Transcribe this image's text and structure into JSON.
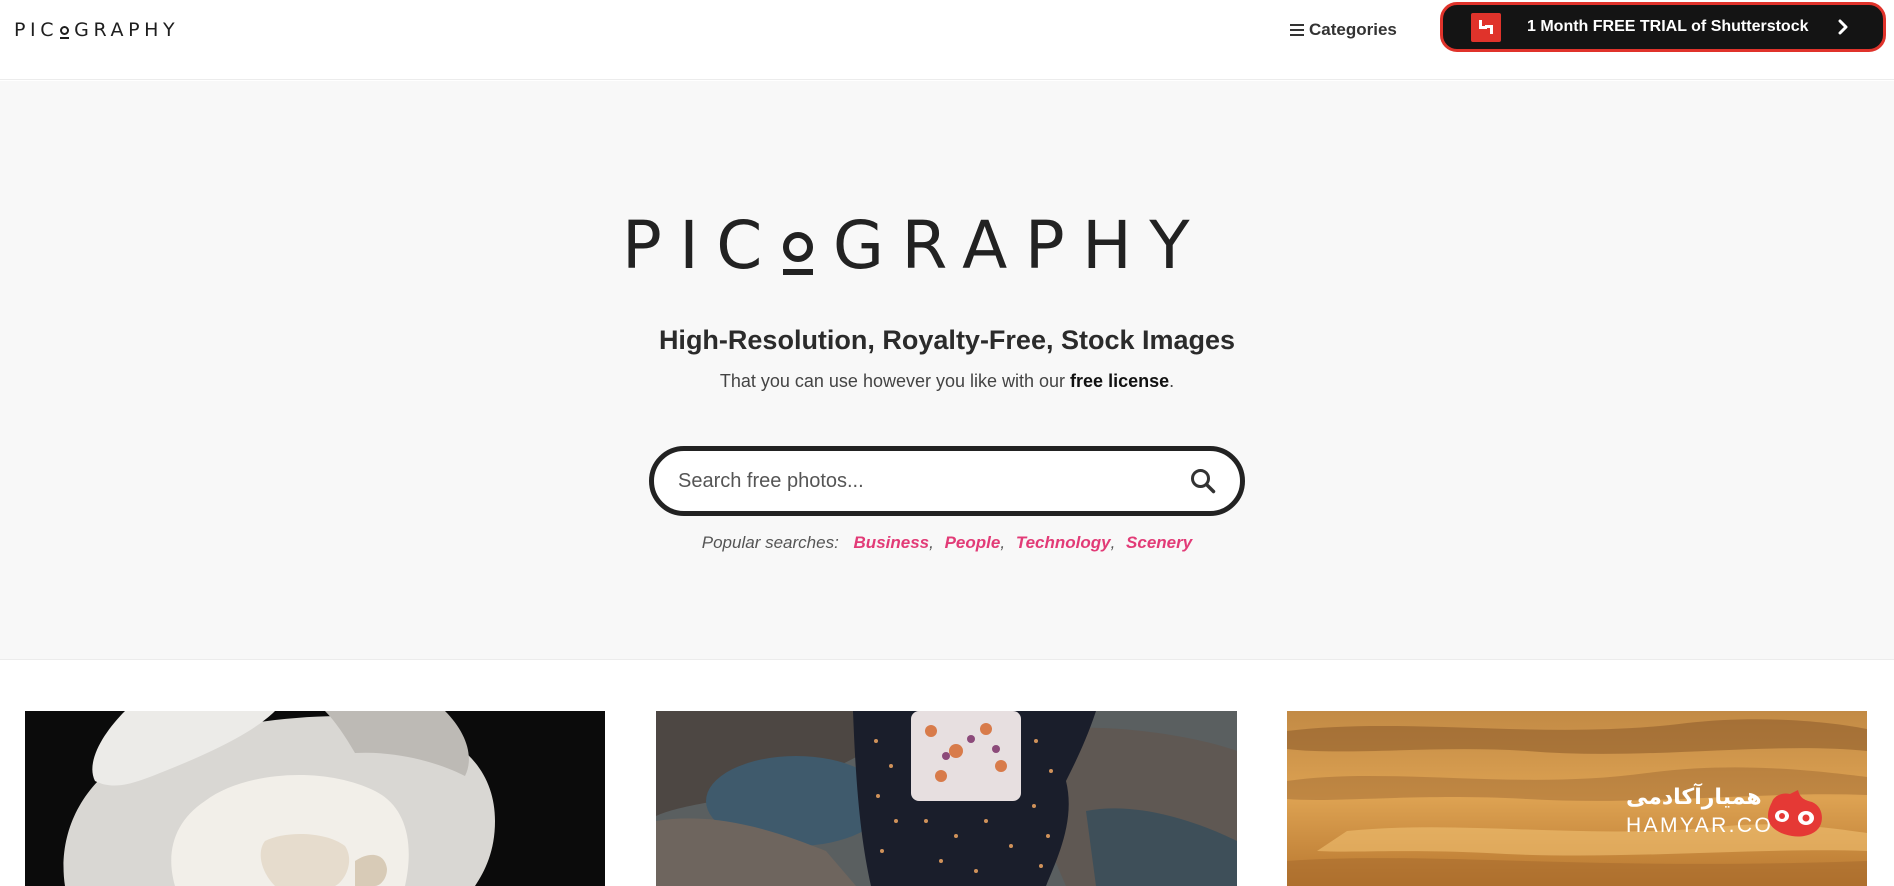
{
  "header": {
    "logo_text_left": "PIC",
    "logo_text_right": "GRAPHY",
    "categories_label": "Categories",
    "trial_button_label": "1 Month FREE TRIAL of Shutterstock"
  },
  "hero": {
    "logo_text_left": "PIC",
    "logo_text_right": "GRAPHY",
    "tagline": "High-Resolution, Royalty-Free, Stock Images",
    "subline_prefix": "That you can use however you like with our ",
    "subline_link": "free license",
    "subline_suffix": "."
  },
  "search": {
    "placeholder": "Search free photos..."
  },
  "popular": {
    "label": "Popular searches:",
    "tags": [
      "Business",
      "People",
      "Technology",
      "Scenery"
    ],
    "separator": ","
  },
  "watermark": {
    "persian_text": "همیارآکادمی",
    "english_text": "HAMYAR.CO"
  },
  "colors": {
    "accent_pink": "#e23b77",
    "shutterstock_red": "#e0332b",
    "dark": "#222222"
  }
}
